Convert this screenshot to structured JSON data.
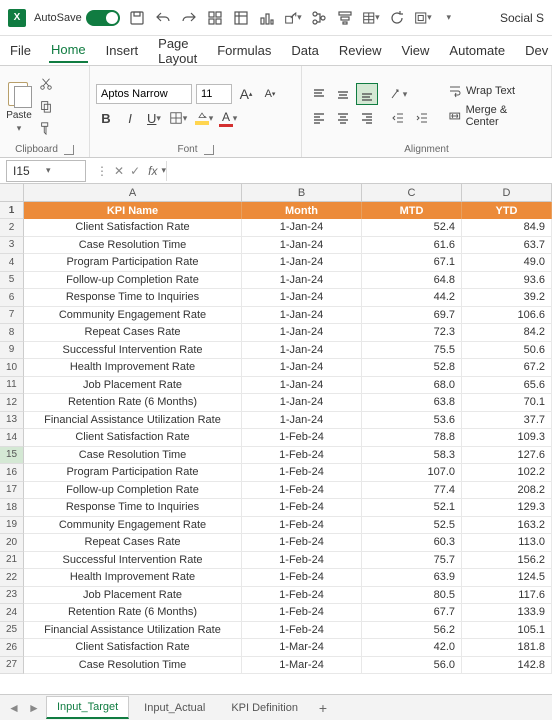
{
  "titlebar": {
    "autosave_label": "AutoSave",
    "doc_hint": "Social S"
  },
  "tabs": [
    "File",
    "Home",
    "Insert",
    "Page Layout",
    "Formulas",
    "Data",
    "Review",
    "View",
    "Automate",
    "Dev"
  ],
  "active_tab": "Home",
  "ribbon": {
    "clipboard": {
      "label": "Clipboard",
      "paste": "Paste"
    },
    "font": {
      "label": "Font",
      "name": "Aptos Narrow",
      "size": "11"
    },
    "alignment": {
      "label": "Alignment",
      "wrap": "Wrap Text",
      "merge": "Merge & Center"
    }
  },
  "namebox": "I15",
  "headers": {
    "a": "KPI Name",
    "b": "Month",
    "c": "MTD",
    "d": "YTD"
  },
  "colheads": [
    "A",
    "B",
    "C",
    "D"
  ],
  "rows": [
    {
      "n": 2,
      "a": "Client Satisfaction Rate",
      "b": "1-Jan-24",
      "c": "52.4",
      "d": "84.9"
    },
    {
      "n": 3,
      "a": "Case Resolution Time",
      "b": "1-Jan-24",
      "c": "61.6",
      "d": "63.7"
    },
    {
      "n": 4,
      "a": "Program Participation Rate",
      "b": "1-Jan-24",
      "c": "67.1",
      "d": "49.0"
    },
    {
      "n": 5,
      "a": "Follow-up Completion Rate",
      "b": "1-Jan-24",
      "c": "64.8",
      "d": "93.6"
    },
    {
      "n": 6,
      "a": "Response Time to Inquiries",
      "b": "1-Jan-24",
      "c": "44.2",
      "d": "39.2"
    },
    {
      "n": 7,
      "a": "Community Engagement Rate",
      "b": "1-Jan-24",
      "c": "69.7",
      "d": "106.6"
    },
    {
      "n": 8,
      "a": "Repeat Cases Rate",
      "b": "1-Jan-24",
      "c": "72.3",
      "d": "84.2"
    },
    {
      "n": 9,
      "a": "Successful Intervention Rate",
      "b": "1-Jan-24",
      "c": "75.5",
      "d": "50.6"
    },
    {
      "n": 10,
      "a": "Health Improvement Rate",
      "b": "1-Jan-24",
      "c": "52.8",
      "d": "67.2"
    },
    {
      "n": 11,
      "a": "Job Placement Rate",
      "b": "1-Jan-24",
      "c": "68.0",
      "d": "65.6"
    },
    {
      "n": 12,
      "a": "Retention Rate (6 Months)",
      "b": "1-Jan-24",
      "c": "63.8",
      "d": "70.1"
    },
    {
      "n": 13,
      "a": "Financial Assistance Utilization Rate",
      "b": "1-Jan-24",
      "c": "53.6",
      "d": "37.7"
    },
    {
      "n": 14,
      "a": "Client Satisfaction Rate",
      "b": "1-Feb-24",
      "c": "78.8",
      "d": "109.3"
    },
    {
      "n": 15,
      "a": "Case Resolution Time",
      "b": "1-Feb-24",
      "c": "58.3",
      "d": "127.6"
    },
    {
      "n": 16,
      "a": "Program Participation Rate",
      "b": "1-Feb-24",
      "c": "107.0",
      "d": "102.2"
    },
    {
      "n": 17,
      "a": "Follow-up Completion Rate",
      "b": "1-Feb-24",
      "c": "77.4",
      "d": "208.2"
    },
    {
      "n": 18,
      "a": "Response Time to Inquiries",
      "b": "1-Feb-24",
      "c": "52.1",
      "d": "129.3"
    },
    {
      "n": 19,
      "a": "Community Engagement Rate",
      "b": "1-Feb-24",
      "c": "52.5",
      "d": "163.2"
    },
    {
      "n": 20,
      "a": "Repeat Cases Rate",
      "b": "1-Feb-24",
      "c": "60.3",
      "d": "113.0"
    },
    {
      "n": 21,
      "a": "Successful Intervention Rate",
      "b": "1-Feb-24",
      "c": "75.7",
      "d": "156.2"
    },
    {
      "n": 22,
      "a": "Health Improvement Rate",
      "b": "1-Feb-24",
      "c": "63.9",
      "d": "124.5"
    },
    {
      "n": 23,
      "a": "Job Placement Rate",
      "b": "1-Feb-24",
      "c": "80.5",
      "d": "117.6"
    },
    {
      "n": 24,
      "a": "Retention Rate (6 Months)",
      "b": "1-Feb-24",
      "c": "67.7",
      "d": "133.9"
    },
    {
      "n": 25,
      "a": "Financial Assistance Utilization Rate",
      "b": "1-Feb-24",
      "c": "56.2",
      "d": "105.1"
    },
    {
      "n": 26,
      "a": "Client Satisfaction Rate",
      "b": "1-Mar-24",
      "c": "42.0",
      "d": "181.8"
    },
    {
      "n": 27,
      "a": "Case Resolution Time",
      "b": "1-Mar-24",
      "c": "56.0",
      "d": "142.8"
    }
  ],
  "sheets": [
    "Input_Target",
    "Input_Actual",
    "KPI Definition"
  ],
  "active_sheet": "Input_Target"
}
